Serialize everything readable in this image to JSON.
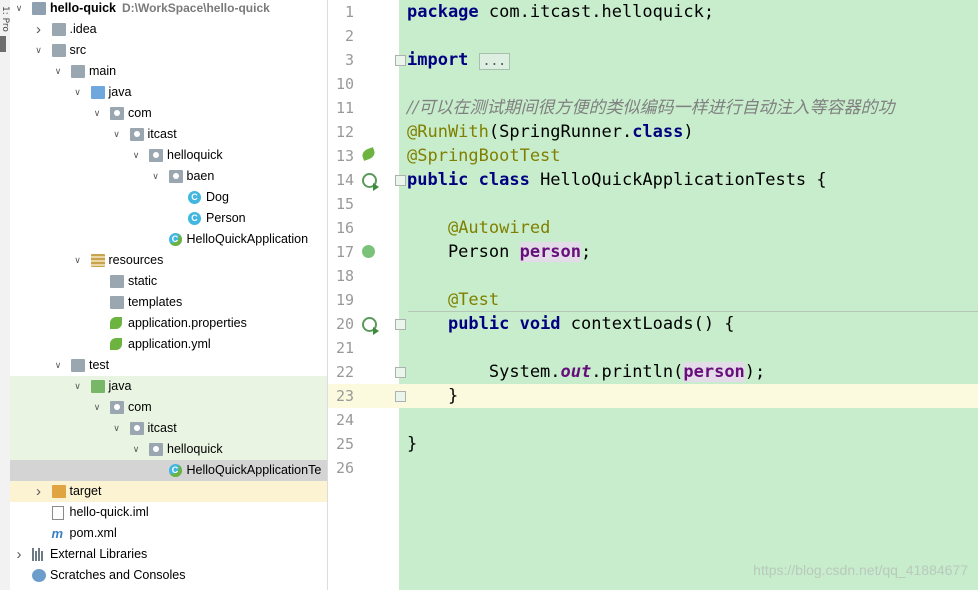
{
  "side_tab": {
    "label": "1: Pro"
  },
  "project_tree": [
    {
      "label": "hello-quick",
      "hint": "D:\\WorkSpace\\hello-quick",
      "indent": 0,
      "arrow": "down",
      "icon": "module-folder-icon",
      "bold": true
    },
    {
      "label": ".idea",
      "indent": 1,
      "arrow": "right",
      "icon": "folder-icon"
    },
    {
      "label": "src",
      "indent": 1,
      "arrow": "down",
      "icon": "folder-icon"
    },
    {
      "label": "main",
      "indent": 2,
      "arrow": "down",
      "icon": "folder-icon"
    },
    {
      "label": "java",
      "indent": 3,
      "arrow": "down",
      "icon": "source-folder-icon"
    },
    {
      "label": "com",
      "indent": 4,
      "arrow": "down",
      "icon": "package-icon"
    },
    {
      "label": "itcast",
      "indent": 5,
      "arrow": "down",
      "icon": "package-icon"
    },
    {
      "label": "helloquick",
      "indent": 6,
      "arrow": "down",
      "icon": "package-icon"
    },
    {
      "label": "baen",
      "indent": 7,
      "arrow": "down",
      "icon": "package-icon"
    },
    {
      "label": "Dog",
      "indent": 8,
      "arrow": "",
      "icon": "class-icon"
    },
    {
      "label": "Person",
      "indent": 8,
      "arrow": "",
      "icon": "class-icon"
    },
    {
      "label": "HelloQuickApplication",
      "indent": 7,
      "arrow": "",
      "icon": "spring-class-icon"
    },
    {
      "label": "resources",
      "indent": 3,
      "arrow": "down",
      "icon": "resources-folder-icon"
    },
    {
      "label": "static",
      "indent": 4,
      "arrow": "",
      "icon": "folder-icon"
    },
    {
      "label": "templates",
      "indent": 4,
      "arrow": "",
      "icon": "folder-icon"
    },
    {
      "label": "application.properties",
      "indent": 4,
      "arrow": "",
      "icon": "spring-config-icon"
    },
    {
      "label": "application.yml",
      "indent": 4,
      "arrow": "",
      "icon": "spring-config-icon"
    },
    {
      "label": "test",
      "indent": 2,
      "arrow": "down",
      "icon": "folder-icon"
    },
    {
      "label": "java",
      "indent": 3,
      "arrow": "down",
      "icon": "test-folder-icon",
      "hl": "test"
    },
    {
      "label": "com",
      "indent": 4,
      "arrow": "down",
      "icon": "package-icon",
      "hl": "test"
    },
    {
      "label": "itcast",
      "indent": 5,
      "arrow": "down",
      "icon": "package-icon",
      "hl": "test"
    },
    {
      "label": "helloquick",
      "indent": 6,
      "arrow": "down",
      "icon": "package-icon",
      "hl": "test"
    },
    {
      "label": "HelloQuickApplicationTe",
      "indent": 7,
      "arrow": "",
      "icon": "test-class-icon",
      "hl": "selected"
    },
    {
      "label": "target",
      "indent": 1,
      "arrow": "right",
      "icon": "excluded-folder-icon",
      "hl": "target"
    },
    {
      "label": "hello-quick.iml",
      "indent": 1,
      "arrow": "",
      "icon": "iml-file-icon"
    },
    {
      "label": "pom.xml",
      "indent": 1,
      "arrow": "",
      "icon": "maven-icon"
    },
    {
      "label": "External Libraries",
      "indent": 0,
      "arrow": "right",
      "icon": "libraries-icon"
    },
    {
      "label": "Scratches and Consoles",
      "indent": 0,
      "arrow": "",
      "icon": "scratches-icon"
    }
  ],
  "editor": {
    "line_numbers": [
      "1",
      "2",
      "3",
      "10",
      "11",
      "12",
      "13",
      "14",
      "15",
      "16",
      "17",
      "18",
      "19",
      "20",
      "21",
      "22",
      "23",
      "24",
      "25",
      "26"
    ],
    "lines": [
      [
        {
          "t": "package ",
          "c": "kw"
        },
        {
          "t": "com.itcast.helloquick;",
          "c": ""
        }
      ],
      [],
      [
        {
          "t": "import ",
          "c": "kw"
        },
        {
          "t": "...",
          "c": "foldbox"
        }
      ],
      [],
      [
        {
          "t": "//可以在测试期间很方便的类似编码一样进行自动注入等容器的功",
          "c": "cmt"
        }
      ],
      [
        {
          "t": "@RunWith",
          "c": "ann"
        },
        {
          "t": "(SpringRunner.",
          "c": ""
        },
        {
          "t": "class",
          "c": "kw"
        },
        {
          "t": ")",
          "c": ""
        }
      ],
      [
        {
          "t": "@SpringBootTest",
          "c": "ann"
        }
      ],
      [
        {
          "t": "public class ",
          "c": "kw"
        },
        {
          "t": "HelloQuickApplicationTests {",
          "c": ""
        }
      ],
      [],
      [
        {
          "t": "    ",
          "c": ""
        },
        {
          "t": "@Autowired",
          "c": "ann"
        }
      ],
      [
        {
          "t": "    Person ",
          "c": ""
        },
        {
          "t": "person",
          "c": "fld hlvar"
        },
        {
          "t": ";",
          "c": ""
        }
      ],
      [],
      [
        {
          "t": "    ",
          "c": ""
        },
        {
          "t": "@Test",
          "c": "ann"
        }
      ],
      [
        {
          "t": "    ",
          "c": ""
        },
        {
          "t": "public void ",
          "c": "kw"
        },
        {
          "t": "contextLoads() {",
          "c": ""
        }
      ],
      [],
      [
        {
          "t": "        System.",
          "c": ""
        },
        {
          "t": "out",
          "c": "italicfld"
        },
        {
          "t": ".println(",
          "c": ""
        },
        {
          "t": "person",
          "c": "fld hlvar"
        },
        {
          "t": ");",
          "c": ""
        }
      ],
      [
        {
          "t": "    }",
          "c": ""
        }
      ],
      [],
      [
        {
          "t": "}",
          "c": ""
        }
      ],
      []
    ]
  },
  "watermark": "https://blog.csdn.net/qq_41884677"
}
